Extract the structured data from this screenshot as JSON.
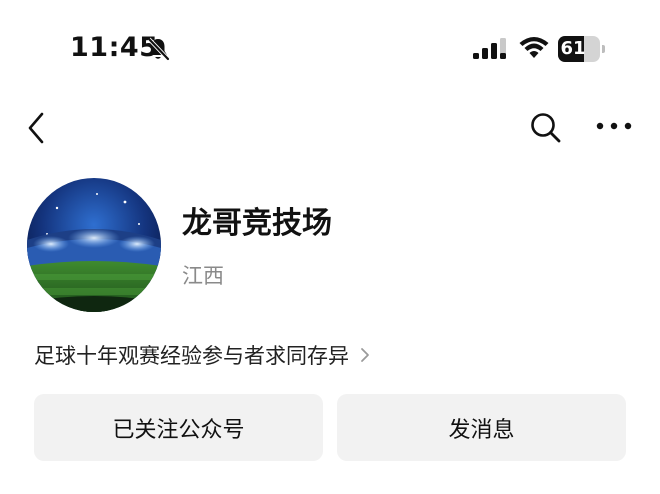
{
  "status_bar": {
    "time": "11:45",
    "battery_level": "61",
    "battery_fraction": 0.61,
    "icons": [
      "bell-slash-icon",
      "cellular-signal-icon",
      "wifi-icon",
      "battery-icon"
    ]
  },
  "nav": {
    "icons": [
      "chevron-left-icon",
      "search-icon",
      "more-icon"
    ]
  },
  "profile": {
    "name": "龙哥竞技场",
    "location": "江西",
    "bio": "足球十年观赛经验参与者求同存异",
    "avatar_icon": "stadium-avatar"
  },
  "actions": {
    "follow_label": "已关注公众号",
    "message_label": "发消息"
  },
  "colors": {
    "background": "#ffffff",
    "button_bg": "#f2f2f2",
    "secondary_text": "#8a8a8a",
    "primary_text": "#111111"
  }
}
